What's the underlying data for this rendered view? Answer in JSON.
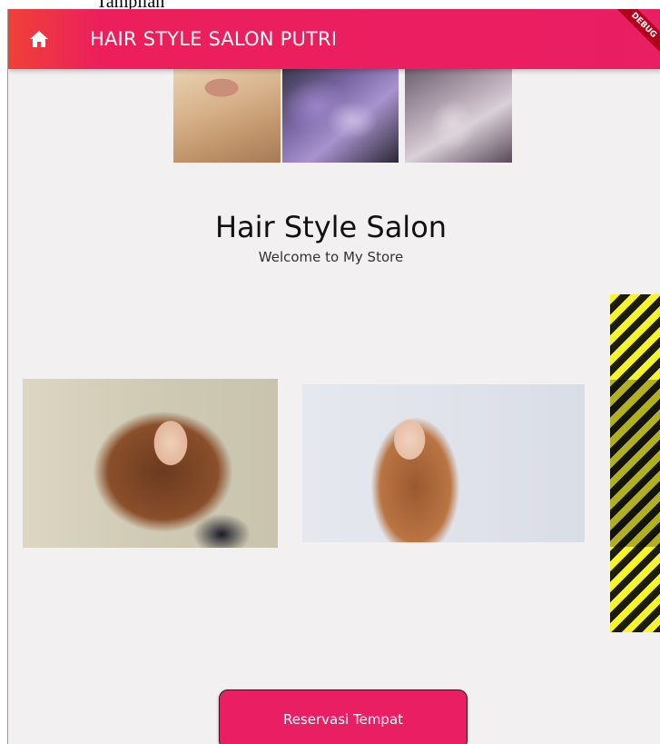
{
  "caption": "Tampilan",
  "appbar": {
    "title": "HAIR STYLE SALON PUTRI",
    "home_icon": "home-icon",
    "debug_banner": "DEBUG"
  },
  "gallery_top": [
    "hair-photo-blonde",
    "hair-photo-lavender",
    "hair-photo-silver"
  ],
  "main": {
    "title": "Hair Style Salon",
    "subtitle": "Welcome to My Store"
  },
  "gallery_middle": [
    "model-photo-curly-brunette",
    "model-photo-straight-auburn"
  ],
  "actions": {
    "reserve_label": "Reservasi Tempat"
  },
  "colors": {
    "appbar": "#e91e63",
    "button": "#e91e63",
    "background": "#f2f0f0"
  }
}
